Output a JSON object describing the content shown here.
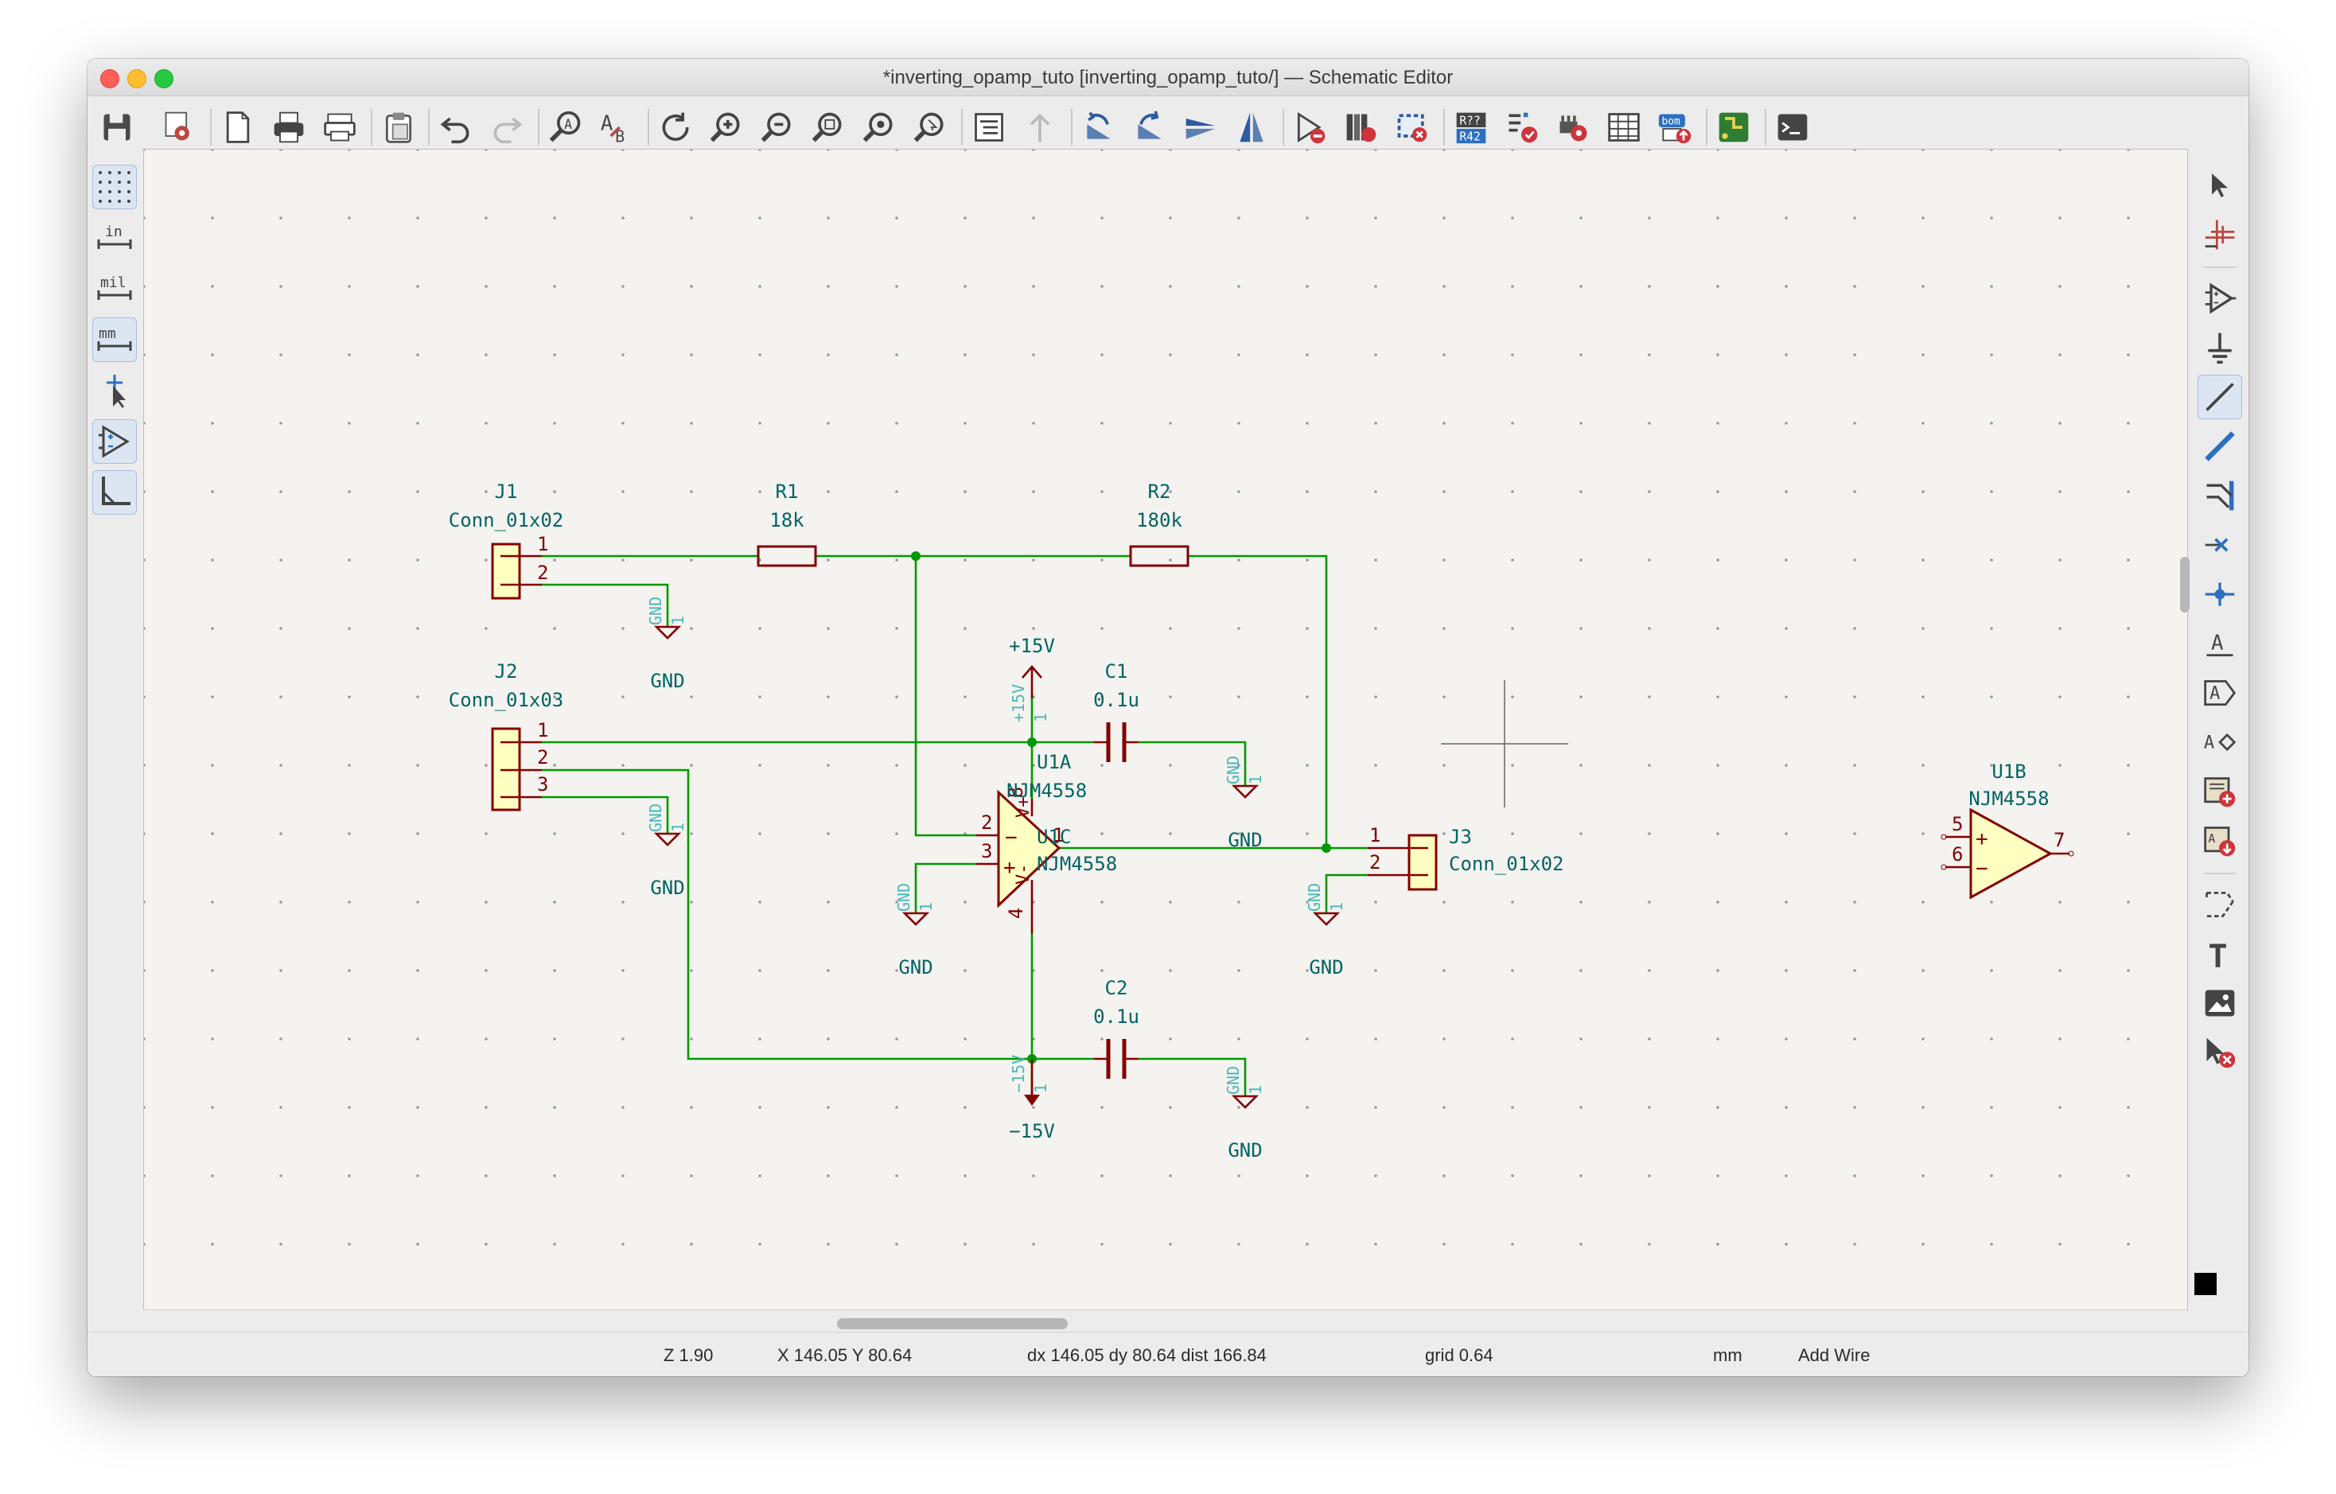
{
  "window": {
    "title": "*inverting_opamp_tuto [inverting_opamp_tuto/] — Schematic Editor"
  },
  "toolbar": {
    "icons": [
      "save-icon",
      "schematic-setup-icon",
      "page-settings-icon",
      "print-icon",
      "plot-icon",
      "paste-icon",
      "undo-icon",
      "redo-icon",
      "find-icon",
      "find-replace-icon",
      "refresh-icon",
      "zoom-in-icon",
      "zoom-out-icon",
      "zoom-fit-icon",
      "zoom-objects-icon",
      "zoom-selection-icon",
      "hierarchy-navigator-icon",
      "leave-sheet-icon",
      "rotate-ccw-icon",
      "rotate-cw-icon",
      "mirror-vertical-icon",
      "mirror-horizontal-icon",
      "symbol-editor-icon",
      "symbol-browser-icon",
      "footprint-assign-icon",
      "annotate-icon",
      "erc-icon",
      "assign-footprints-icon",
      "edit-fields-table-icon",
      "bom-icon",
      "update-pcb-icon",
      "scripting-console-icon"
    ],
    "annotate_label": "R??\nR42",
    "bom_label": "bom"
  },
  "left_toolbar": {
    "items": [
      {
        "name": "grid-toggle",
        "label": "",
        "active": true
      },
      {
        "name": "units-inches",
        "label": "in",
        "active": false
      },
      {
        "name": "units-mils",
        "label": "mil",
        "active": false
      },
      {
        "name": "units-mm",
        "label": "mm",
        "active": true
      },
      {
        "name": "cursor-full-crosshair",
        "label": "",
        "active": false
      },
      {
        "name": "hidden-pins",
        "label": "",
        "active": true
      },
      {
        "name": "line-mode-45",
        "label": "",
        "active": true
      }
    ]
  },
  "right_toolbar": {
    "items": [
      "select-icon",
      "highlight-net-icon",
      "add-symbol-icon",
      "add-power-icon",
      "add-wire-icon",
      "add-bus-icon",
      "add-bus-entry-icon",
      "no-connect-icon",
      "add-junction-icon",
      "add-label-icon",
      "add-global-label-icon",
      "add-hier-label-icon",
      "add-sheet-icon",
      "import-sheet-pin-icon",
      "add-graphic-line-icon",
      "add-text-icon",
      "add-image-icon",
      "delete-tool-icon"
    ],
    "text_icon_label": "T",
    "label_icon_label": "A"
  },
  "schematic": {
    "components": {
      "J1": {
        "ref": "J1",
        "value": "Conn_01x02",
        "pins": [
          "1",
          "2"
        ]
      },
      "J2": {
        "ref": "J2",
        "value": "Conn_01x03",
        "pins": [
          "1",
          "2",
          "3"
        ]
      },
      "J3": {
        "ref": "J3",
        "value": "Conn_01x02",
        "pins": [
          "1",
          "2"
        ]
      },
      "R1": {
        "ref": "R1",
        "value": "18k"
      },
      "R2": {
        "ref": "R2",
        "value": "180k"
      },
      "C1": {
        "ref": "C1",
        "value": "0.1u"
      },
      "C2": {
        "ref": "C2",
        "value": "0.1u"
      },
      "U1A": {
        "ref": "U1A",
        "value": "NJM4558",
        "pins": [
          "2",
          "3",
          "1"
        ]
      },
      "U1C": {
        "ref": "U1C",
        "value": "NJM4558",
        "pins": [
          "8",
          "4"
        ],
        "pin_names": [
          "V+",
          "V-"
        ]
      },
      "U1B": {
        "ref": "U1B",
        "value": "NJM4558",
        "pins": [
          "5",
          "6",
          "7"
        ]
      }
    },
    "power": {
      "pos15": {
        "label": "+15V",
        "pin_name": "+15V",
        "pin_num": "1"
      },
      "neg15": {
        "label": "−15V",
        "pin_name": "−15V",
        "pin_num": "1"
      },
      "gnd": {
        "label": "GND",
        "pin_name": "GND",
        "pin_num": "1"
      }
    },
    "opamp_signs": {
      "plus": "+",
      "minus": "−"
    }
  },
  "status": {
    "zoom": "Z 1.90",
    "xy": "X 146.05  Y 80.64",
    "delta": "dx 146.05  dy 80.64  dist 166.84",
    "grid": "grid 0.64",
    "units": "mm",
    "tool": "Add Wire"
  },
  "colors": {
    "wire": "#009900",
    "component": "#840000",
    "body_fill": "#ffffc2",
    "reference": "#006464",
    "pin_name_hidden": "#48b8b8",
    "canvas_bg": "#f4f3ef",
    "grid_dot": "#9a9a9a"
  }
}
